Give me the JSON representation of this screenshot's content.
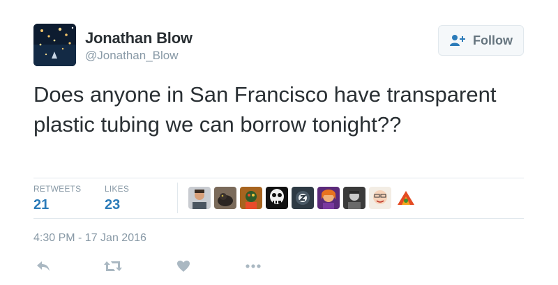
{
  "tweet": {
    "author_name": "Jonathan Blow",
    "author_handle": "@Jonathan_Blow",
    "follow_label": "Follow",
    "text": "Does anyone in San Francisco have transparent plastic tubing we can borrow tonight??",
    "stats": {
      "retweets_label": "RETWEETS",
      "retweets_value": "21",
      "likes_label": "LIKES",
      "likes_value": "23"
    },
    "timestamp": "4:30 PM - 17 Jan 2016",
    "likers": [
      "liker-1",
      "liker-2",
      "liker-3",
      "liker-4",
      "liker-5",
      "liker-6",
      "liker-7",
      "liker-8",
      "liker-9"
    ],
    "actions": [
      "reply-icon",
      "retweet-icon",
      "heart-icon",
      "more-icon"
    ],
    "colors": {
      "link_blue": "#2b7bb9",
      "muted_gray": "#8899a6",
      "text_dark": "#292f33",
      "divider": "#e1e8ed"
    }
  }
}
